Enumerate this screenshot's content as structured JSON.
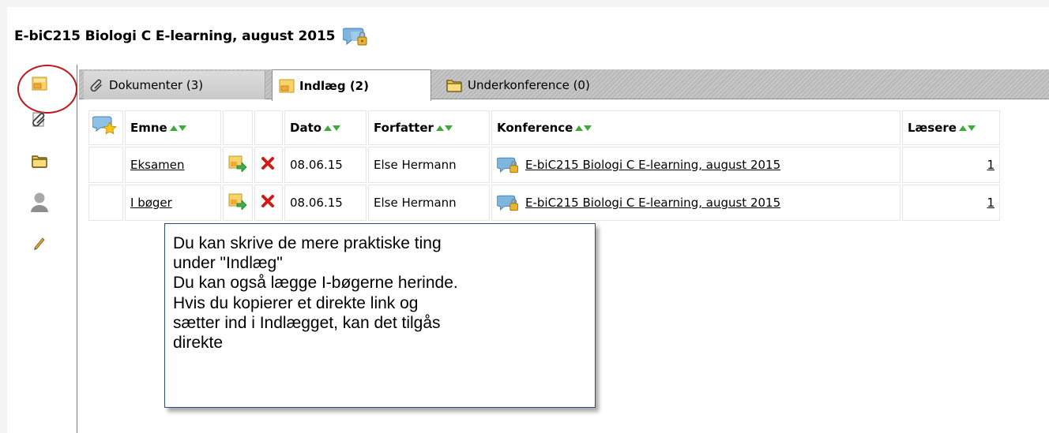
{
  "header": {
    "title": "E-biC215 Biologi C E-learning, august 2015",
    "title_icon": "conference-lock-icon"
  },
  "sidebar": {
    "items": [
      {
        "name": "posts",
        "icon": "post-icon",
        "highlighted": true
      },
      {
        "name": "documents",
        "icon": "paperclip-icon"
      },
      {
        "name": "subconferences",
        "icon": "folder-icon"
      },
      {
        "name": "people",
        "icon": "person-icon"
      },
      {
        "name": "edit",
        "icon": "pencil-icon"
      }
    ]
  },
  "tabs": [
    {
      "label": "Dokumenter (3)",
      "icon": "paperclip-icon",
      "active": false
    },
    {
      "label": "Indlæg (2)",
      "icon": "post-icon",
      "active": true
    },
    {
      "label": "Underkonference (0)",
      "icon": "folder-icon",
      "active": false
    }
  ],
  "table": {
    "headers": {
      "subject": "Emne",
      "date": "Dato",
      "author": "Forfatter",
      "conference": "Konference",
      "readers": "Læsere"
    },
    "rows": [
      {
        "subject": "Eksamen",
        "date": "08.06.15",
        "author": "Else Hermann",
        "conference": "E-biC215 Biologi C E-learning, august 2015",
        "readers": "1"
      },
      {
        "subject": "I bøger",
        "date": "08.06.15",
        "author": "Else Hermann",
        "conference": "E-biC215 Biologi C E-learning, august 2015",
        "readers": "1"
      }
    ]
  },
  "callout": {
    "lines": [
      "Du kan skrive de mere praktiske ting",
      "under \"Indlæg\"",
      "Du kan også lægge I-bøgerne herinde.",
      "Hvis du kopierer et direkte link og",
      "sætter ind i Indlægget, kan det tilgås",
      "direkte"
    ]
  },
  "colors": {
    "sort_arrow": "#3daa3b",
    "highlight_circle": "#c0161b",
    "callout_border": "#2e4f74",
    "delete": "#d11a1a"
  }
}
